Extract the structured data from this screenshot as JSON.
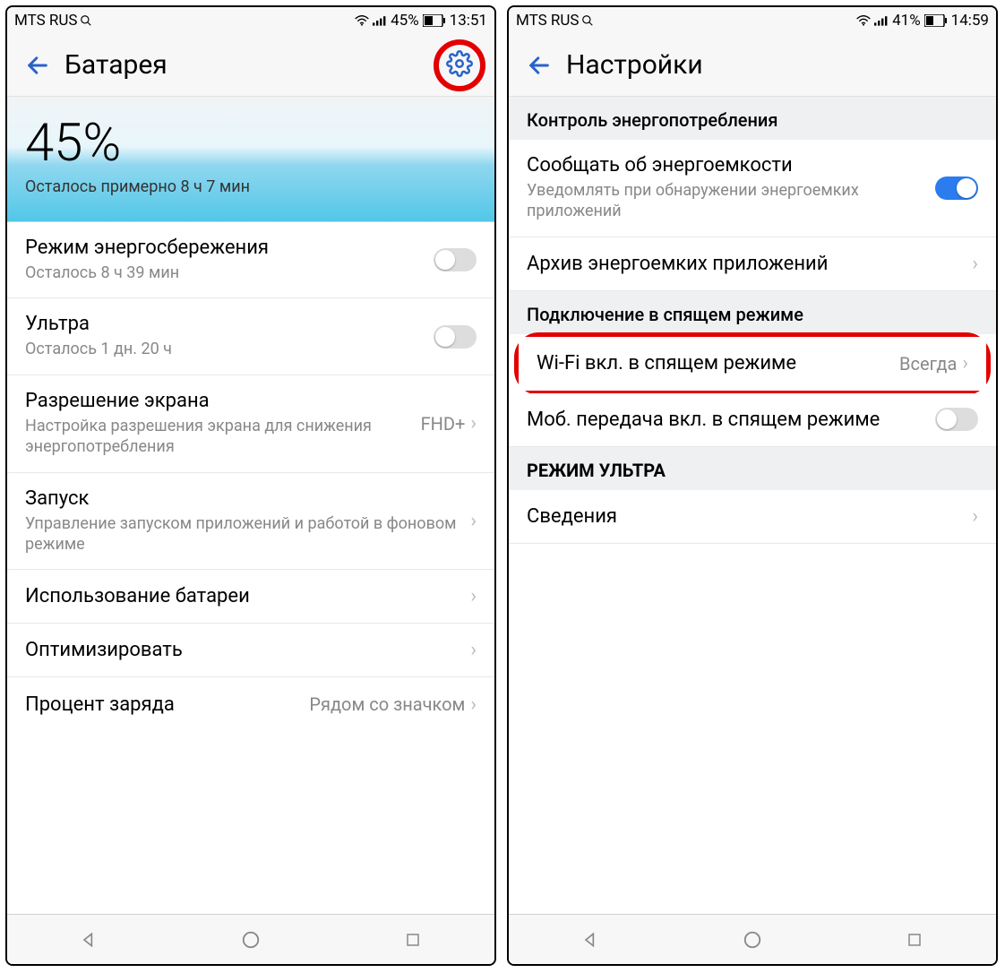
{
  "left": {
    "statusbar": {
      "carrier": "MTS RUS",
      "battery_pct": "45%",
      "time": "13:51"
    },
    "header": {
      "title": "Батарея"
    },
    "hero": {
      "percent": "45%",
      "remaining": "Осталось примерно 8 ч 7 мин"
    },
    "rows": {
      "power_save": {
        "title": "Режим энергосбережения",
        "sub": "Осталось 8 ч 39 мин"
      },
      "ultra": {
        "title": "Ультра",
        "sub": "Осталось 1 дн. 20 ч"
      },
      "resolution": {
        "title": "Разрешение экрана",
        "sub": "Настройка разрешения экрана для снижения энергопотребления",
        "value": "FHD+"
      },
      "launch": {
        "title": "Запуск",
        "sub": "Управление запуском приложений и работой в фоновом режиме"
      },
      "usage": {
        "title": "Использование батареи"
      },
      "optimize": {
        "title": "Оптимизировать"
      },
      "percent_label": {
        "title": "Процент заряда",
        "value": "Рядом со значком"
      }
    }
  },
  "right": {
    "statusbar": {
      "carrier": "MTS RUS",
      "battery_pct": "41%",
      "time": "14:59"
    },
    "header": {
      "title": "Настройки"
    },
    "sections": {
      "power_control": "Контроль энергопотребления",
      "sleep_conn": "Подключение в спящем режиме",
      "ultra_mode": "РЕЖИМ УЛЬТРА"
    },
    "rows": {
      "notify_heavy": {
        "title": "Сообщать об энергоемкости",
        "sub": "Уведомлять при обнаружении энергоемких приложений"
      },
      "archive": {
        "title": "Архив энергоемких приложений"
      },
      "wifi_sleep": {
        "title": "Wi-Fi вкл. в спящем режиме",
        "value": "Всегда"
      },
      "mobile_sleep": {
        "title": "Моб. передача вкл. в спящем режиме"
      },
      "info": {
        "title": "Сведения"
      }
    }
  }
}
